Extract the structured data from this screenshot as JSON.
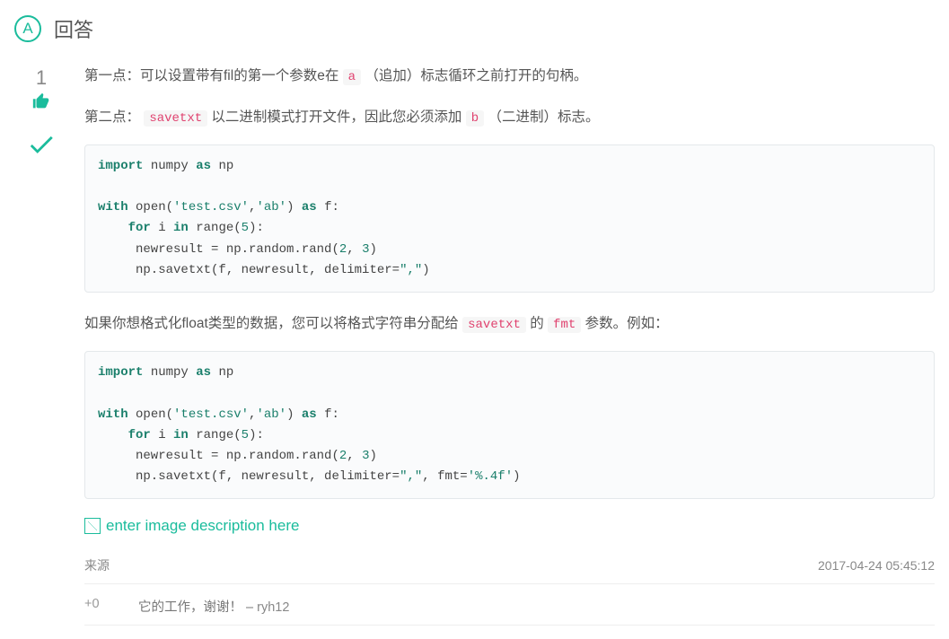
{
  "header": {
    "badge": "A",
    "title": "回答"
  },
  "vote": {
    "count": "1"
  },
  "paragraphs": {
    "p1_a": "第一点：可以设置带有fil的第一个参数e在 ",
    "p1_code": "a",
    "p1_b": " （追加）标志循环之前打开的句柄。",
    "p2_a": "第二点： ",
    "p2_code": "savetxt",
    "p2_b": " 以二进制模式打开文件，因此您必须添加 ",
    "p2_code2": "b",
    "p2_c": " （二进制）标志。",
    "p3_a": "如果你想格式化float类型的数据，您可以将格式字符串分配给 ",
    "p3_code1": "savetxt",
    "p3_b": " 的 ",
    "p3_code2": "fmt",
    "p3_c": " 参数。例如："
  },
  "code1": {
    "l1a": "import",
    "l1b": " numpy ",
    "l1c": "as",
    "l1d": " np",
    "l2a": "with",
    "l2b": " open(",
    "l2c": "'test.csv'",
    "l2d": ",",
    "l2e": "'ab'",
    "l2f": ") ",
    "l2g": "as",
    "l2h": " f:",
    "l3a": "    for",
    "l3b": " i ",
    "l3c": "in",
    "l3d": " range(",
    "l3e": "5",
    "l3f": "):",
    "l4a": "     newresult = np.random.rand(",
    "l4b": "2",
    "l4c": ", ",
    "l4d": "3",
    "l4e": ")",
    "l5a": "     np.savetxt(f, newresult, delimiter=",
    "l5b": "\",\"",
    "l5c": ")"
  },
  "code2": {
    "l1a": "import",
    "l1b": " numpy ",
    "l1c": "as",
    "l1d": " np",
    "l2a": "with",
    "l2b": " open(",
    "l2c": "'test.csv'",
    "l2d": ",",
    "l2e": "'ab'",
    "l2f": ") ",
    "l2g": "as",
    "l2h": " f:",
    "l3a": "    for",
    "l3b": " i ",
    "l3c": "in",
    "l3d": " range(",
    "l3e": "5",
    "l3f": "):",
    "l4a": "     newresult = np.random.rand(",
    "l4b": "2",
    "l4c": ", ",
    "l4d": "3",
    "l4e": ")",
    "l5a": "     np.savetxt(f, newresult, delimiter=",
    "l5b": "\",\"",
    "l5c": ", fmt=",
    "l5d": "'%.4f'",
    "l5e": ")"
  },
  "image_link": {
    "text": "enter image description here"
  },
  "meta": {
    "source": "来源",
    "timestamp": "2017-04-24 05:45:12"
  },
  "comment": {
    "score": "+0",
    "text": "它的工作，谢谢！",
    "sep": " – ",
    "author": "ryh12"
  }
}
